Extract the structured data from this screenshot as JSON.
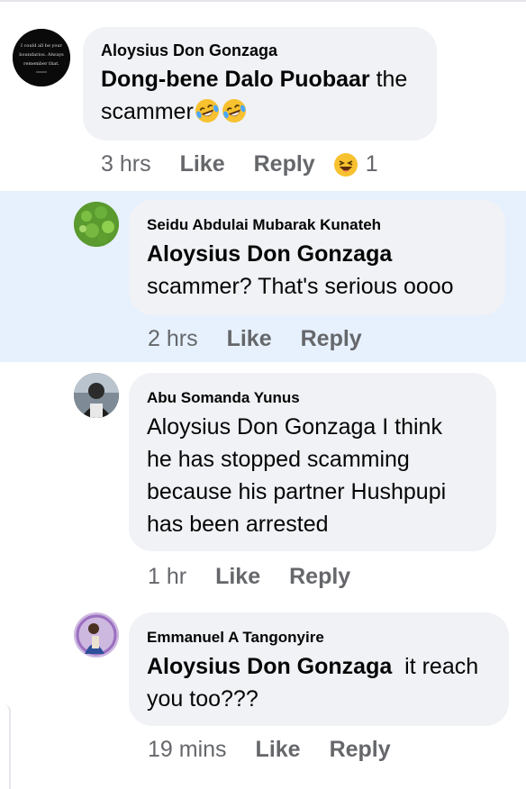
{
  "comments": [
    {
      "author": "Aloysius Don Gonzaga",
      "mention": "Dong-bene Dalo Puobaar",
      "text_after_mention": " the",
      "text_line2": "scammer",
      "emojis": [
        "rofl",
        "rofl"
      ],
      "time": "3 hrs",
      "like_label": "Like",
      "reply_label": "Reply",
      "reaction_emoji": "laughing",
      "reaction_count": "1",
      "avatar_text": [
        "I could all be your",
        "boundarios. Always",
        "remember that."
      ]
    },
    {
      "author": "Seidu Abdulai Mubarak Kunateh",
      "mention": "Aloysius Don Gonzaga",
      "text": "scammer? That's serious oooo",
      "time": "2 hrs",
      "like_label": "Like",
      "reply_label": "Reply",
      "highlighted": true
    },
    {
      "author": "Abu Somanda Yunus",
      "lines": [
        "Aloysius Don Gonzaga I think",
        "he has stopped scamming",
        "because his partner Hushpupi",
        "has been arrested"
      ],
      "time": "1 hr",
      "like_label": "Like",
      "reply_label": "Reply"
    },
    {
      "author": "Emmanuel A Tangonyire",
      "mention": "Aloysius Don Gonzaga",
      "text_after_mention": "  it reach",
      "text_line2": "you too???",
      "time": "19 mins",
      "like_label": "Like",
      "reply_label": "Reply"
    }
  ],
  "colors": {
    "bubble": "#f0f2f5",
    "highlight": "#e7f1fd",
    "secondary_text": "#65676b",
    "primary_text": "#050505"
  }
}
